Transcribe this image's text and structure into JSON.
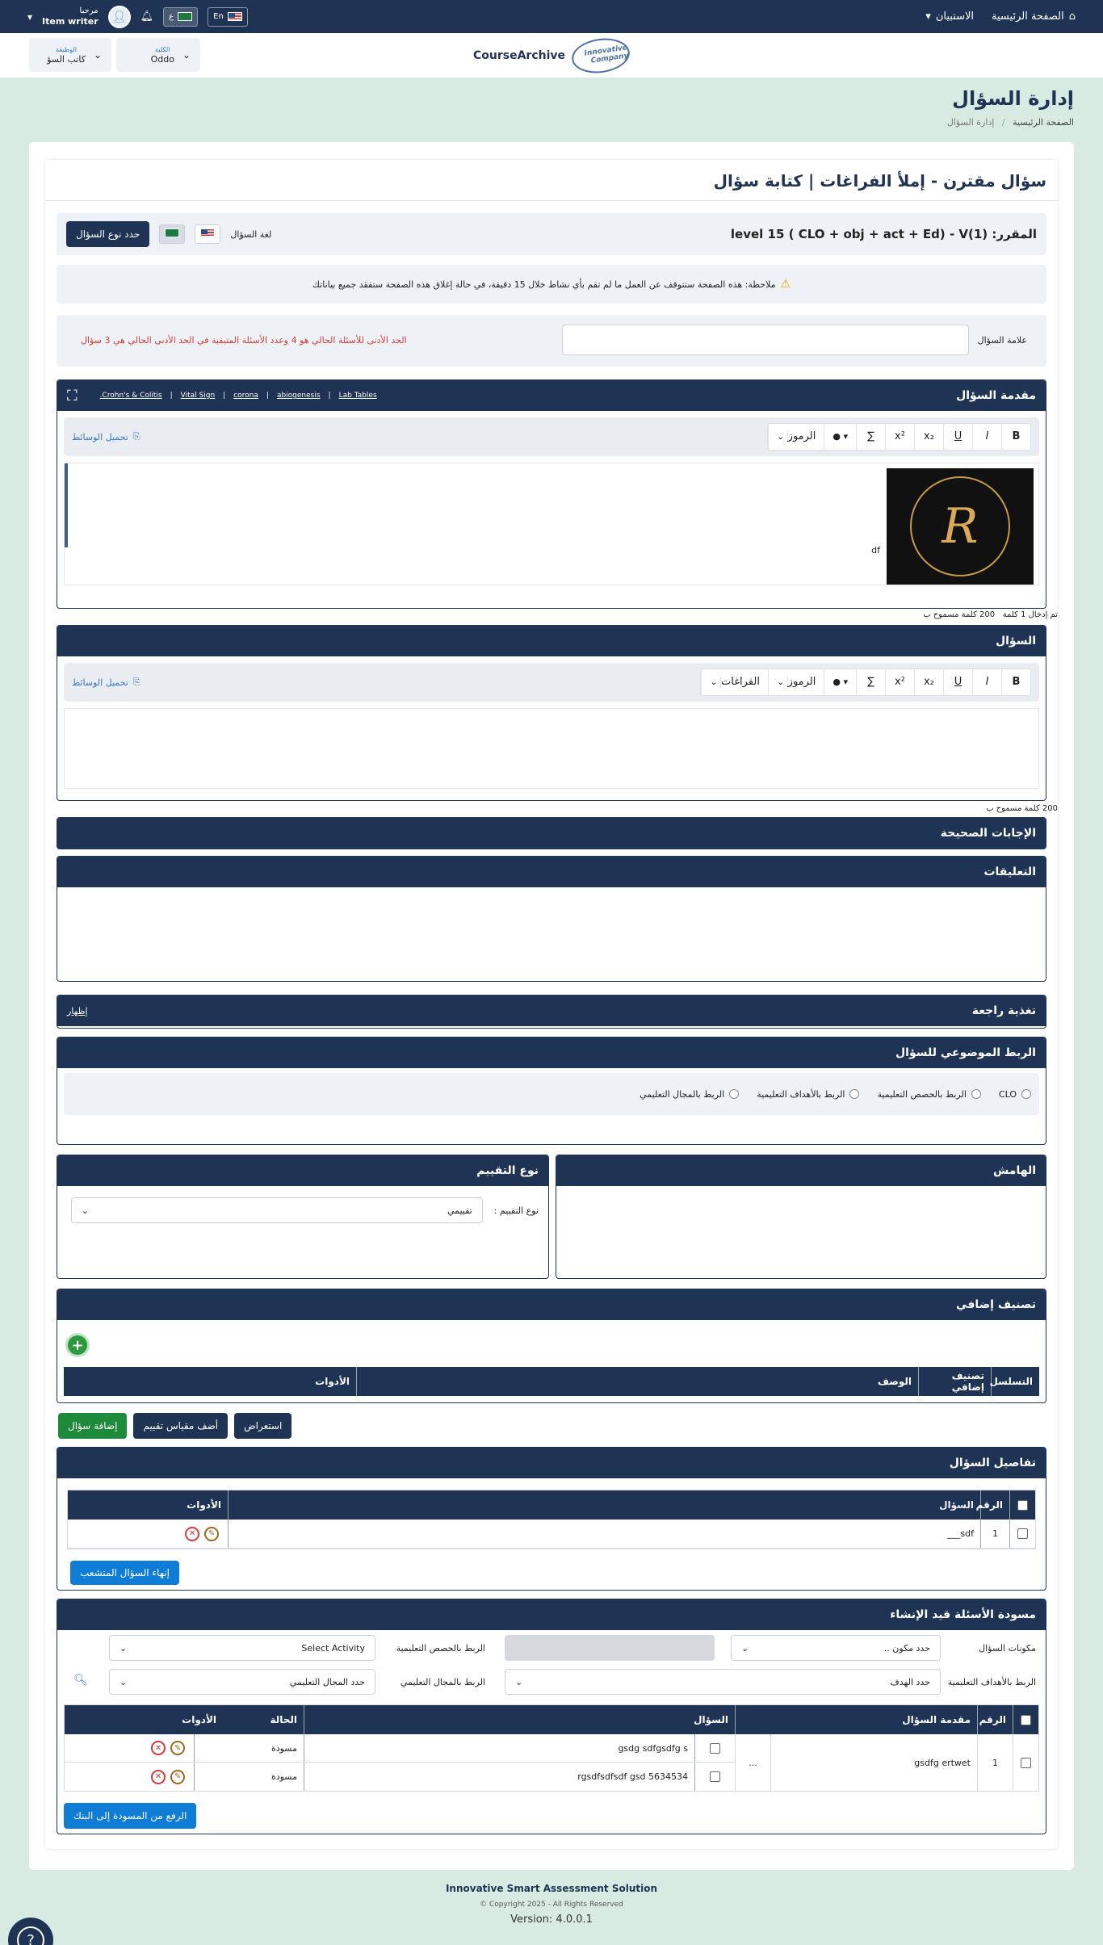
{
  "topbar": {
    "home": "الصفحة الرئيسية",
    "questionnaire": "الاستبيان",
    "lang_en": "En",
    "lang_ar": "ع",
    "greeting": "مرحبا",
    "username": "Item writer"
  },
  "header": {
    "brand": "CourseArchive",
    "logo_text": "Innovative Company",
    "college_label": "الكلية",
    "college_value": "Oddo",
    "role_label": "الوظيفة",
    "role_value": "كاتب السؤ"
  },
  "page": {
    "title": "إدارة السؤال",
    "breadcrumb_home": "الصفحة الرئيسية",
    "breadcrumb_sep": "/",
    "breadcrumb_current": "إدارة السؤال"
  },
  "card": {
    "title": "سؤال مقترن - إملأ الفراغات | كتابة سؤال",
    "course_label": "المقرر:",
    "course_value": "level 15 ( CLO + obj + act + Ed) - V(1)",
    "question_lang_label": "لغة السؤال",
    "select_type_button": "حدد نوع السؤال",
    "notice": "ملاحظة: هذه الصفحة ستتوقف عن العمل ما لم تقم بأي نشاط خلال 15 دقيقة، في حالة إغلاق هذه الصفحة ستفقد جميع بياناتك",
    "mark_label": "علامة السؤال",
    "min_warning": "الحد الأدنى للأسئلة الحالي هو 4 وعدد الأسئلة المتبقية في الحد الأدنى الحالي هي 3 سؤال"
  },
  "intro": {
    "title": "مقدمة السؤال",
    "links": [
      "Lab Tables",
      "abiogenesis",
      "corona",
      "Vital Sign",
      "Crohn's & Colitis."
    ],
    "link_sep": "|",
    "symbols_label": "الرموز",
    "upload_label": "تحميل الوسائط",
    "editor_text": "df",
    "count_text": "تم إدخال 1 كلمة",
    "allowed_text": "200 كلمة مسموح ب"
  },
  "question": {
    "title": "السؤال",
    "symbols_label": "الرموز",
    "blanks_label": "الفراغات",
    "upload_label": "تحميل الوسائط",
    "allowed_text": "200 كلمة مسموح ب"
  },
  "tools": {
    "bold": "B",
    "italic": "I",
    "underline": "U",
    "sub": "x₂",
    "sup": "x²",
    "sum": "∑"
  },
  "sections": {
    "correct_answers": "الإجابات الصحيحة",
    "comments": "التعليقات",
    "feedback": "تغذية راجعة",
    "feedback_show": "إظهار",
    "linking": "الربط الموضوعي للسؤال",
    "margin": "الهامش",
    "eval_type": "نوع التقييم",
    "eval_type_label": "نوع التقييم :",
    "eval_type_value": "تقييمي",
    "extra_class": "تصنيف إضافي"
  },
  "linking_options": [
    "CLO",
    "الربط بالحصص التعليمية",
    "الربط بالأهداف التعليمية",
    "الربط بالمجال التعليمي"
  ],
  "extra_table": {
    "headers": [
      "التسلسل",
      "تصنيف إضافي",
      "الوصف",
      "الأدوات"
    ]
  },
  "actions": {
    "add_question": "إضافة سؤال",
    "add_rubric": "أضف مقياس تقييم",
    "preview": "استعراض"
  },
  "details": {
    "title": "تفاصيل السؤال",
    "headers": [
      "الرقم",
      "السؤال",
      "الأدوات"
    ],
    "rows": [
      {
        "num": "1",
        "text": "___sdf"
      }
    ],
    "finish_button": "إنهاء السؤال المتشعب"
  },
  "draft": {
    "title": "مسودة الأسئلة قيد الإنشاء",
    "components_label": "مكونات السؤال",
    "components_value": "حدد مكون ..",
    "lessons_label": "الربط بالحصص التعليمية",
    "activity_value": "Select Activity",
    "objectives_label": "الربط بالأهداف التعليمية",
    "objective_value": "حدد الهدف",
    "domain_label": "الربط بالمجال التعليمي",
    "domain_value": "حدد المجال التعليمي",
    "headers": [
      "الرقم",
      "مقدمة السؤال",
      "السؤال",
      "الحالة",
      "الأدوات"
    ],
    "group": {
      "num": "1",
      "intro": "gsdfg ertwet",
      "more": "..."
    },
    "rows": [
      {
        "text": "gsdg sdfgsdfg s",
        "status": "مسودة"
      },
      {
        "text": "rgsdfsdfsdf gsd 5634534",
        "status": "مسودة"
      }
    ],
    "upload_button": "الرفع من المسودة إلى البنك"
  },
  "footer": {
    "title": "Innovative Smart Assessment Solution",
    "copyright": "Copyright 2025 - All Rights Reserved ©",
    "version": "Version: 4.0.0.1"
  }
}
